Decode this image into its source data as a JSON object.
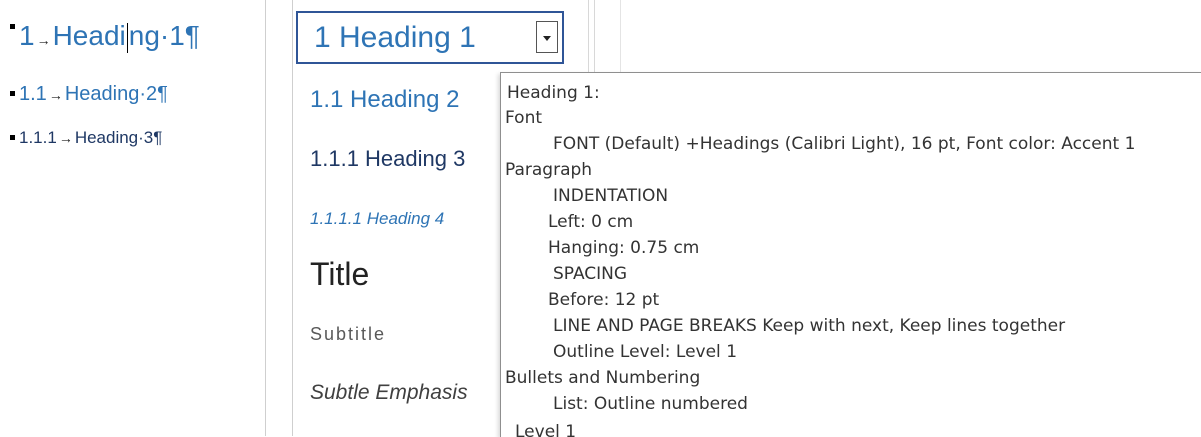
{
  "document": {
    "h1": {
      "number": "1",
      "text": "Heading·1"
    },
    "h2": {
      "number": "1.1",
      "text": "Heading·2"
    },
    "h3": {
      "number": "1.1.1",
      "text": "Heading·3"
    },
    "arrow": "→",
    "pilcrow": "¶"
  },
  "style_pane": {
    "selected": "1  Heading 1",
    "items": {
      "h2": "1.1  Heading 2",
      "h3": "1.1.1  Heading 3",
      "h4": "1.1.1.1  Heading 4",
      "title": "Title",
      "subtitle": "Subtitle",
      "subtle": "Subtle Emphasis"
    }
  },
  "tooltip": {
    "lines": [
      "Heading 1:",
      "Font",
      "FONT  (Default) +Headings (Calibri Light), 16 pt, Font color: Accent 1",
      "Paragraph",
      "INDENTATION",
      "Left:  0 cm",
      "Hanging:  0.75 cm",
      "SPACING",
      "Before:  12 pt",
      "LINE AND PAGE BREAKS  Keep with next, Keep lines together",
      "Outline Level:  Level 1",
      "Bullets and Numbering",
      "List:  Outline numbered",
      "Level 1"
    ]
  },
  "colors": {
    "heading_blue": "#2e74b5",
    "box_border": "#2f5597"
  }
}
